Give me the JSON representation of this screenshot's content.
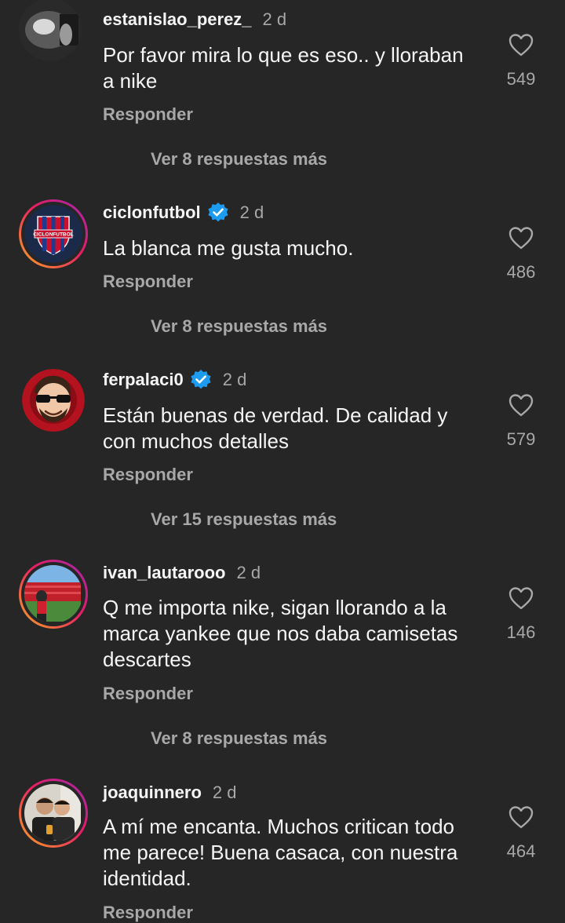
{
  "comments": [
    {
      "username": "estanislao_perez_",
      "time": "2 d",
      "verified": false,
      "text": "Por favor mira lo que es eso.. y lloraban a nike",
      "likes": "549",
      "reply_label": "Responder",
      "more_label": "Ver 8 respuestas más"
    },
    {
      "username": "ciclonfutbol",
      "time": "2 d",
      "verified": true,
      "text": "La blanca me gusta mucho.",
      "likes": "486",
      "reply_label": "Responder",
      "more_label": "Ver 8 respuestas más",
      "avatar_text": "CICLONFUTBOL"
    },
    {
      "username": "ferpalaci0",
      "time": "2 d",
      "verified": true,
      "text": "Están buenas de verdad. De calidad y con muchos detalles",
      "likes": "579",
      "reply_label": "Responder",
      "more_label": "Ver 15 respuestas más"
    },
    {
      "username": "ivan_lautarooo",
      "time": "2 d",
      "verified": false,
      "text": "Q me importa nike, sigan llorando a la marca yankee que nos daba camisetas descartes",
      "likes": "146",
      "reply_label": "Responder",
      "more_label": "Ver 8 respuestas más"
    },
    {
      "username": "joaquinnero",
      "time": "2 d",
      "verified": false,
      "text": "A mí me encanta. Muchos critican todo me parece! Buena casaca, con nuestra identidad.",
      "likes": "464",
      "reply_label": "Responder"
    }
  ],
  "colors": {
    "background": "#262626",
    "text": "#f5f5f5",
    "secondary": "#a8a8a8",
    "verified": "#1d9bf0"
  }
}
